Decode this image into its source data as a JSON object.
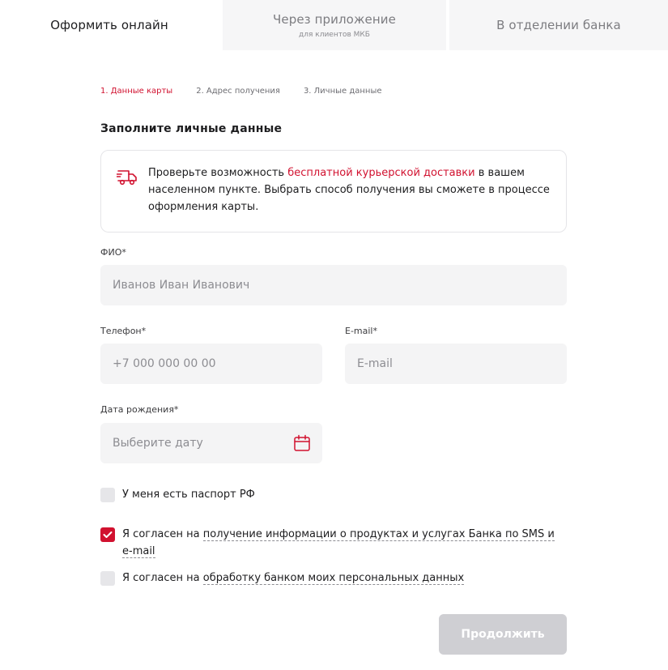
{
  "tabs": [
    {
      "label": "Оформить онлайн",
      "sub": ""
    },
    {
      "label": "Через приложение",
      "sub": "для клиентов МКБ"
    },
    {
      "label": "В отделении банка",
      "sub": ""
    }
  ],
  "steps": [
    "1. Данные карты",
    "2. Адрес получения",
    "3. Личные данные"
  ],
  "form_title": "Заполните личные данные",
  "info": {
    "icon": "delivery-truck-icon",
    "text_before": "Проверьте возможность ",
    "link": "бесплатной курьерской доставки",
    "text_after": " в вашем населенном пункте. Выбрать способ получения вы сможете в процессе оформления карты."
  },
  "fields": {
    "fio": {
      "label": "ФИО*",
      "placeholder": "Иванов Иван Иванович"
    },
    "phone": {
      "label": "Телефон*",
      "placeholder": "+7 000 000 00 00"
    },
    "email": {
      "label": "E-mail*",
      "placeholder": "E-mail"
    },
    "birthdate": {
      "label": "Дата рождения*",
      "placeholder": "Выберите дату",
      "icon": "calendar-icon"
    }
  },
  "checkboxes": {
    "passport": {
      "label": "У меня есть паспорт РФ",
      "checked": false
    },
    "sms_consent": {
      "prefix": "Я согласен на ",
      "link": "получение информации о продуктах и услугах Банка по SMS и e-mail",
      "checked": true
    },
    "data_consent": {
      "prefix": "Я согласен на ",
      "link": "обработку банком моих персональных данных",
      "checked": false
    }
  },
  "continue_label": "Продолжить",
  "colors": {
    "accent": "#d1112f",
    "field_bg": "#f4f4f5",
    "disabled_button": "#cfcfd3"
  }
}
